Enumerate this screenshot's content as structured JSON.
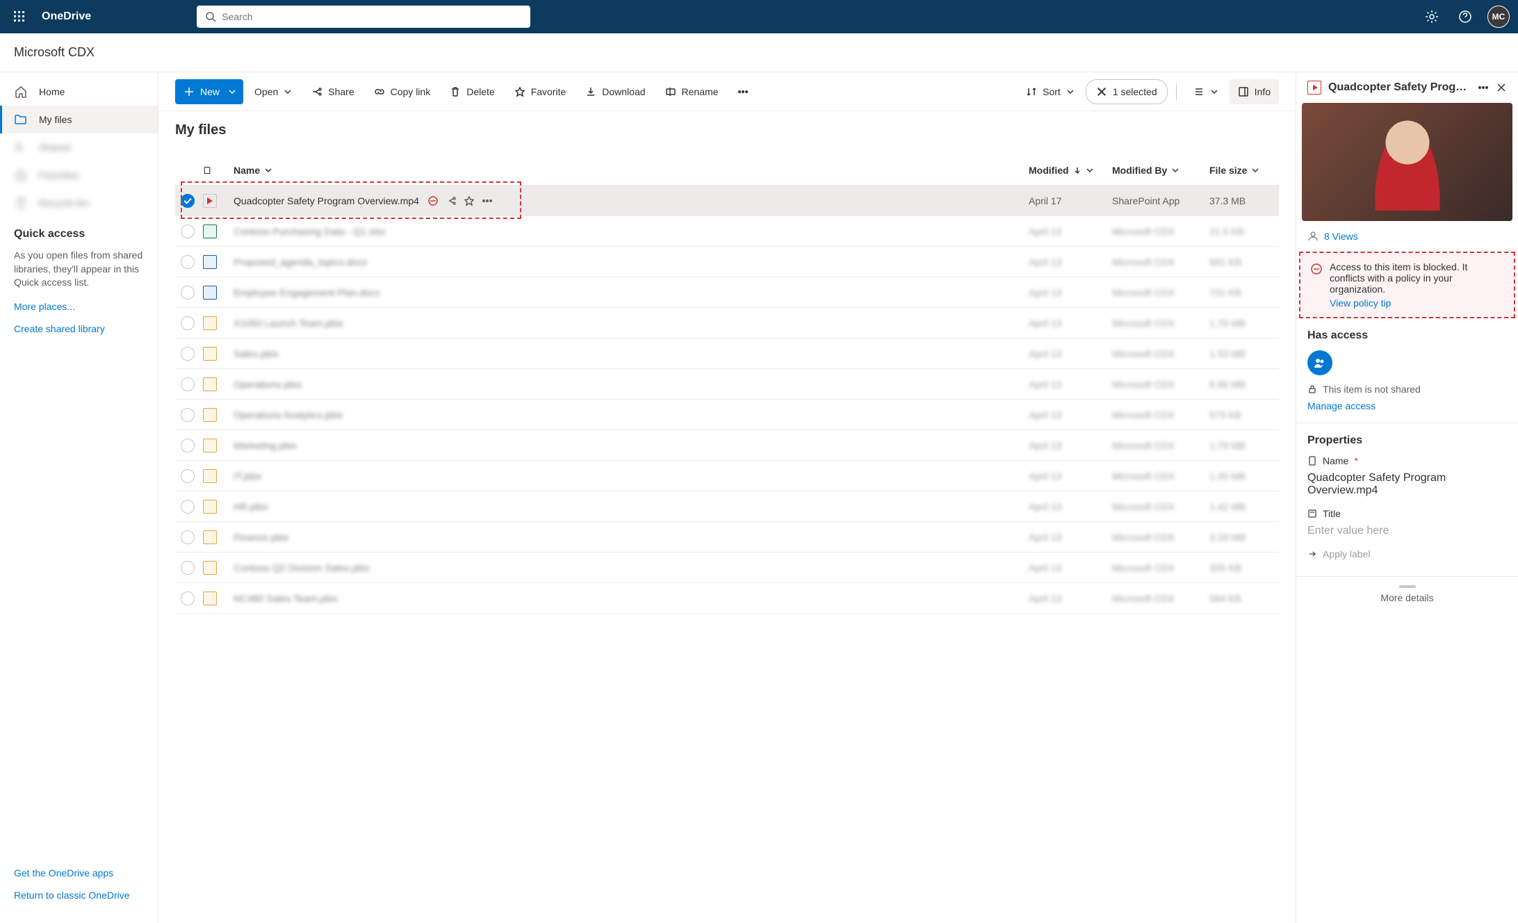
{
  "topbar": {
    "app_name": "OneDrive",
    "search_placeholder": "Search",
    "avatar": "MC"
  },
  "org": {
    "name": "Microsoft CDX"
  },
  "sidebar": {
    "items": [
      {
        "label": "Home",
        "icon": "home",
        "active": false
      },
      {
        "label": "My files",
        "icon": "folder",
        "active": true
      },
      {
        "label": "Shared",
        "icon": "people",
        "blurred": true
      },
      {
        "label": "Favorites",
        "icon": "star",
        "blurred": true
      },
      {
        "label": "Recycle bin",
        "icon": "trash",
        "blurred": true
      }
    ],
    "quick_title": "Quick access",
    "quick_text": "As you open files from shared libraries, they'll appear in this Quick access list.",
    "more_places": "More places...",
    "create_lib": "Create shared library",
    "get_apps": "Get the OneDrive apps",
    "return_classic": "Return to classic OneDrive"
  },
  "cmdbar": {
    "new": "New",
    "open": "Open",
    "share": "Share",
    "copy_link": "Copy link",
    "delete": "Delete",
    "favorite": "Favorite",
    "download": "Download",
    "rename": "Rename",
    "sort": "Sort",
    "selected": "1 selected",
    "info": "Info"
  },
  "list": {
    "title": "My files",
    "cols": {
      "name": "Name",
      "modified": "Modified",
      "modified_by": "Modified By",
      "size": "File size"
    },
    "rows": [
      {
        "selected": true,
        "icon": "video",
        "name": "Quadcopter Safety Program Overview.mp4",
        "modified": "April 17",
        "by": "SharePoint App",
        "size": "37.3 MB"
      },
      {
        "blurred": true,
        "icon": "xlsx",
        "name": "Contoso Purchasing Data - Q1.xlsx",
        "modified": "April 13",
        "by": "Microsoft CDX",
        "size": "21.5 KB"
      },
      {
        "blurred": true,
        "icon": "docx",
        "name": "Proposed_agenda_topics.docx",
        "modified": "April 13",
        "by": "Microsoft CDX",
        "size": "691 KB"
      },
      {
        "blurred": true,
        "icon": "docx",
        "name": "Employee Engagement Plan.docx",
        "modified": "April 13",
        "by": "Microsoft CDX",
        "size": "731 KB"
      },
      {
        "blurred": true,
        "icon": "generic",
        "name": "X1050 Launch Team.pbix",
        "modified": "April 13",
        "by": "Microsoft CDX",
        "size": "1.79 MB"
      },
      {
        "blurred": true,
        "icon": "generic",
        "name": "Sales.pbix",
        "modified": "April 13",
        "by": "Microsoft CDX",
        "size": "1.53 MB"
      },
      {
        "blurred": true,
        "icon": "generic",
        "name": "Operations.pbix",
        "modified": "April 13",
        "by": "Microsoft CDX",
        "size": "6.86 MB"
      },
      {
        "blurred": true,
        "icon": "generic",
        "name": "Operations Analytics.pbix",
        "modified": "April 13",
        "by": "Microsoft CDX",
        "size": "573 KB"
      },
      {
        "blurred": true,
        "icon": "generic",
        "name": "Marketing.pbix",
        "modified": "April 13",
        "by": "Microsoft CDX",
        "size": "1.79 MB"
      },
      {
        "blurred": true,
        "icon": "generic",
        "name": "IT.pbix",
        "modified": "April 13",
        "by": "Microsoft CDX",
        "size": "1.35 MB"
      },
      {
        "blurred": true,
        "icon": "generic",
        "name": "HR.pbix",
        "modified": "April 13",
        "by": "Microsoft CDX",
        "size": "1.42 MB"
      },
      {
        "blurred": true,
        "icon": "generic",
        "name": "Finance.pbix",
        "modified": "April 13",
        "by": "Microsoft CDX",
        "size": "3.18 MB"
      },
      {
        "blurred": true,
        "icon": "generic",
        "name": "Contoso Q2 Division Sales.pbix",
        "modified": "April 13",
        "by": "Microsoft CDX",
        "size": "305 KB"
      },
      {
        "blurred": true,
        "icon": "generic",
        "name": "NC460 Sales Team.pbix",
        "modified": "April 13",
        "by": "Microsoft CDX",
        "size": "584 KB"
      }
    ]
  },
  "details": {
    "title": "Quadcopter Safety Progr…",
    "views": "8 Views",
    "alert_text": "Access to this item is blocked. It conflicts with a policy in your organization.",
    "alert_link": "View policy tip",
    "has_access": "Has access",
    "not_shared": "This item is not shared",
    "manage_access": "Manage access",
    "properties": "Properties",
    "name_label": "Name",
    "name_value": "Quadcopter Safety Program Overview.mp4",
    "title_label": "Title",
    "title_placeholder": "Enter value here",
    "apply_label": "Apply label",
    "more": "More details"
  }
}
